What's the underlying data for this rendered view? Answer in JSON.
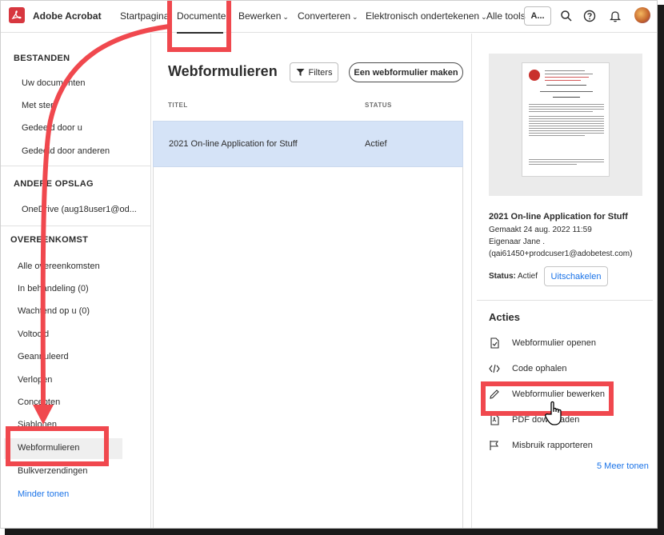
{
  "app": {
    "name": "Adobe Acrobat"
  },
  "topnav": {
    "items": [
      {
        "label": "Startpagina",
        "dropdown": false
      },
      {
        "label": "Documenten",
        "dropdown": false,
        "active": true
      },
      {
        "label": "Bewerken",
        "dropdown": true
      },
      {
        "label": "Converteren",
        "dropdown": true
      },
      {
        "label": "Elektronisch ondertekenen",
        "dropdown": true
      },
      {
        "label": "Alle tools",
        "dropdown": false
      }
    ],
    "account_button": "A...",
    "chevron": "⌄"
  },
  "sidebar": {
    "bestanden": {
      "heading": "BESTANDEN",
      "items": [
        "Uw documenten",
        "Met ster",
        "Gedeeld door u",
        "Gedeeld door anderen"
      ]
    },
    "andere_opslag": {
      "heading": "ANDERE OPSLAG",
      "items": [
        "OneDrive (aug18user1@od..."
      ]
    },
    "overeenkomst": {
      "heading": "OVEREENKOMST",
      "items": [
        "Alle overeenkomsten",
        "In behandeling (0)",
        "Wachtend op u (0)",
        "Voltooid",
        "Geannuleerd",
        "Verlopen",
        "Concepten",
        "Sjablonen",
        "Webformulieren",
        "Bulkverzendingen"
      ],
      "less_link": "Minder tonen"
    }
  },
  "main": {
    "title": "Webformulieren",
    "filters_label": "Filters",
    "create_label": "Een webformulier maken",
    "columns": {
      "title": "TITEL",
      "status": "STATUS"
    },
    "rows": [
      {
        "title": "2021 On-line Application for Stuff",
        "status": "Actief"
      }
    ]
  },
  "details": {
    "title": "2021 On-line Application for Stuff",
    "created": "Gemaakt 24 aug. 2022 11:59",
    "owner": "Eigenaar Jane .",
    "email": "(qai61450+prodcuser1@adobetest.com)",
    "status_label": "Status:",
    "status_value": "Actief",
    "disable_label": "Uitschakelen",
    "actions_heading": "Acties",
    "actions": [
      {
        "label": "Webformulier openen",
        "icon": "form-open-icon"
      },
      {
        "label": "Code ophalen",
        "icon": "code-icon"
      },
      {
        "label": "Webformulier bewerken",
        "icon": "pencil-icon"
      },
      {
        "label": "PDF downloaden",
        "icon": "pdf-download-icon"
      },
      {
        "label": "Misbruik rapporteren",
        "icon": "flag-icon"
      }
    ],
    "more_link": "5 Meer tonen"
  },
  "colors": {
    "accent_red": "#f0484e",
    "link_blue": "#1a73e8",
    "selected_row": "#d5e3f7",
    "brand_red": "#d7373f"
  }
}
